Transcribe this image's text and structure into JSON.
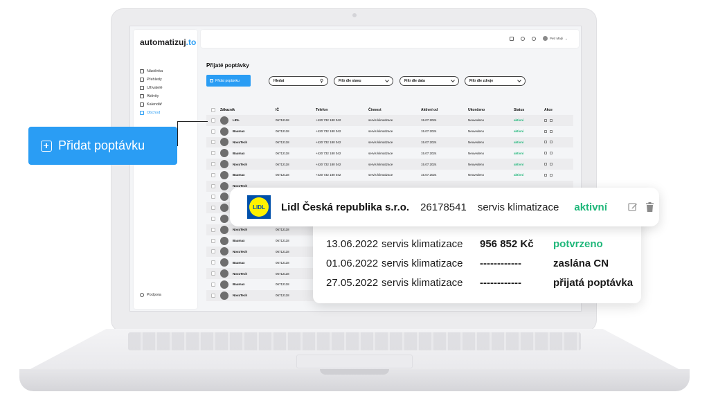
{
  "app": {
    "logo_main": "automatizuj",
    "logo_tld": ".to",
    "user_name": "Petr Malý"
  },
  "sidebar": {
    "items": [
      {
        "label": "Nástěnka",
        "icon": "dashboard-icon"
      },
      {
        "label": "Přehledy",
        "icon": "reports-icon"
      },
      {
        "label": "Uživatelé",
        "icon": "users-icon"
      },
      {
        "label": "Aktivity",
        "icon": "activities-icon"
      },
      {
        "label": "Kalendář",
        "icon": "calendar-icon"
      },
      {
        "label": "Obchod",
        "icon": "shop-icon"
      }
    ],
    "support_label": "Podpora"
  },
  "main": {
    "title": "Přijaté poptávky",
    "add_button_label": "Přidat poptávku",
    "search_placeholder": "Hledat",
    "filters": [
      "Filtr dle stavu",
      "Filtr dle data",
      "Filtr dle zdroje"
    ]
  },
  "table": {
    "columns": [
      "Zákazník",
      "IČ",
      "Telefon",
      "Činnost",
      "Aktivní od",
      "Ukončeno",
      "Status",
      "Akce"
    ],
    "rows": [
      {
        "name": "LIDL",
        "ic": "06712118",
        "tel": "+420 732 180 042",
        "cin": "servis klimatizace",
        "od": "15.07.2024",
        "uk": "Neuvedeno",
        "st": "aktivní"
      },
      {
        "name": "Baumax",
        "ic": "06712118",
        "tel": "+420 732 180 042",
        "cin": "servis klimatizace",
        "od": "15.07.2024",
        "uk": "Neuvedeno",
        "st": "aktivní"
      },
      {
        "name": "NovaTech",
        "ic": "06712118",
        "tel": "+420 732 180 042",
        "cin": "servis klimatizace",
        "od": "15.07.2024",
        "uk": "Neuvedeno",
        "st": "aktivní"
      },
      {
        "name": "Baumax",
        "ic": "06712118",
        "tel": "+420 732 180 042",
        "cin": "servis klimatizace",
        "od": "15.07.2024",
        "uk": "Neuvedeno",
        "st": "aktivní"
      },
      {
        "name": "NovaTech",
        "ic": "06712118",
        "tel": "+420 732 180 042",
        "cin": "servis klimatizace",
        "od": "15.07.2024",
        "uk": "Neuvedeno",
        "st": "aktivní"
      },
      {
        "name": "Baumax",
        "ic": "06712118",
        "tel": "+420 732 180 042",
        "cin": "servis klimatizace",
        "od": "15.07.2024",
        "uk": "Neuvedeno",
        "st": "aktivní"
      },
      {
        "name": "NovaTech",
        "ic": "",
        "tel": "",
        "cin": "",
        "od": "",
        "uk": "",
        "st": ""
      },
      {
        "name": "",
        "ic": "",
        "tel": "",
        "cin": "",
        "od": "",
        "uk": "",
        "st": ""
      },
      {
        "name": "",
        "ic": "",
        "tel": "",
        "cin": "",
        "od": "",
        "uk": "",
        "st": ""
      },
      {
        "name": "",
        "ic": "",
        "tel": "",
        "cin": "",
        "od": "",
        "uk": "",
        "st": ""
      },
      {
        "name": "NovaTech",
        "ic": "06712118",
        "tel": "",
        "cin": "",
        "od": "",
        "uk": "",
        "st": ""
      },
      {
        "name": "Baumax",
        "ic": "06712118",
        "tel": "",
        "cin": "",
        "od": "",
        "uk": "",
        "st": ""
      },
      {
        "name": "NovaTech",
        "ic": "06712118",
        "tel": "",
        "cin": "",
        "od": "",
        "uk": "",
        "st": ""
      },
      {
        "name": "Baumax",
        "ic": "06712118",
        "tel": "",
        "cin": "",
        "od": "",
        "uk": "",
        "st": ""
      },
      {
        "name": "NovaTech",
        "ic": "06712118",
        "tel": "",
        "cin": "",
        "od": "",
        "uk": "",
        "st": ""
      },
      {
        "name": "Baumax",
        "ic": "06712118",
        "tel": "",
        "cin": "",
        "od": "",
        "uk": "",
        "st": ""
      },
      {
        "name": "NovaTech",
        "ic": "06712118",
        "tel": "",
        "cin": "",
        "od": "",
        "uk": "",
        "st": ""
      }
    ]
  },
  "callout": {
    "label": "Přidat poptávku"
  },
  "highlight": {
    "logo_text": "LIDL",
    "company": "Lidl Česká republika s.r.o.",
    "ic": "26178541",
    "activity": "servis klimatizace",
    "status": "aktivní",
    "status_color": "#1fb77a"
  },
  "history": [
    {
      "date": "13.06.2022",
      "activity": "servis klimatizace",
      "amount": "956 852 Kč",
      "status": "potvrzeno"
    },
    {
      "date": "01.06.2022",
      "activity": "servis klimatizace",
      "amount": "------------",
      "status": "zaslána CN"
    },
    {
      "date": "27.05.2022",
      "activity": "servis klimatizace",
      "amount": "------------",
      "status": "přijatá poptávka"
    }
  ],
  "colors": {
    "accent": "#2a9df4",
    "success": "#1fb77a"
  }
}
